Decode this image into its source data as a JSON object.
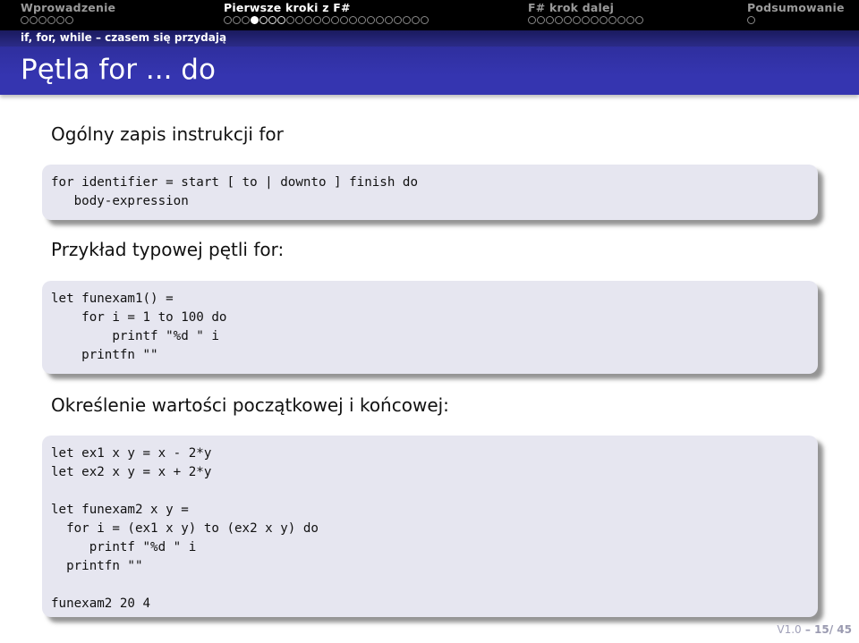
{
  "nav": {
    "sections": [
      {
        "title": "Wprowadzenie",
        "current": false,
        "dots": [
          "o",
          "o",
          "o",
          "o",
          "o",
          "o"
        ]
      },
      {
        "title": "Pierwsze kroki z F#",
        "current": true,
        "dots": [
          "o",
          "o",
          "o",
          "filled",
          "bright",
          "bright",
          "bright",
          "o",
          "o",
          "o",
          "o",
          "o",
          "o",
          "o",
          "o",
          "o",
          "o",
          "o",
          "o",
          "o",
          "o",
          "o",
          "o"
        ]
      },
      {
        "title": "F# krok dalej",
        "current": false,
        "dots": [
          "o",
          "o",
          "o",
          "o",
          "o",
          "o",
          "o",
          "o",
          "o",
          "o",
          "o",
          "o",
          "o"
        ]
      },
      {
        "title": "Podsumowanie",
        "current": false,
        "dots": [
          "o"
        ]
      }
    ],
    "subsection": "if, for, while – czasem się przydają"
  },
  "frame": {
    "title": "Pętla for ... do"
  },
  "content": {
    "heading1": "Ogólny zapis instrukcji for",
    "code1": "for identifier = start [ to | downto ] finish do\n   body-expression",
    "heading2": "Przykład typowej pętli for:",
    "code2": "let funexam1() =\n    for i = 1 to 100 do\n        printf \"%d \" i\n    printfn \"\"",
    "heading3": "Określenie wartości początkowej i końcowej:",
    "code3": "let ex1 x y = x - 2*y\nlet ex2 x y = x + 2*y\n\nlet funexam2 x y =\n  for i = (ex1 x y) to (ex2 x y) do\n     printf \"%d \" i\n  printfn \"\"\n\nfunexam2 20 4"
  },
  "footer": {
    "version": "V1.0",
    "separator": " – ",
    "page": "15/ 45"
  }
}
